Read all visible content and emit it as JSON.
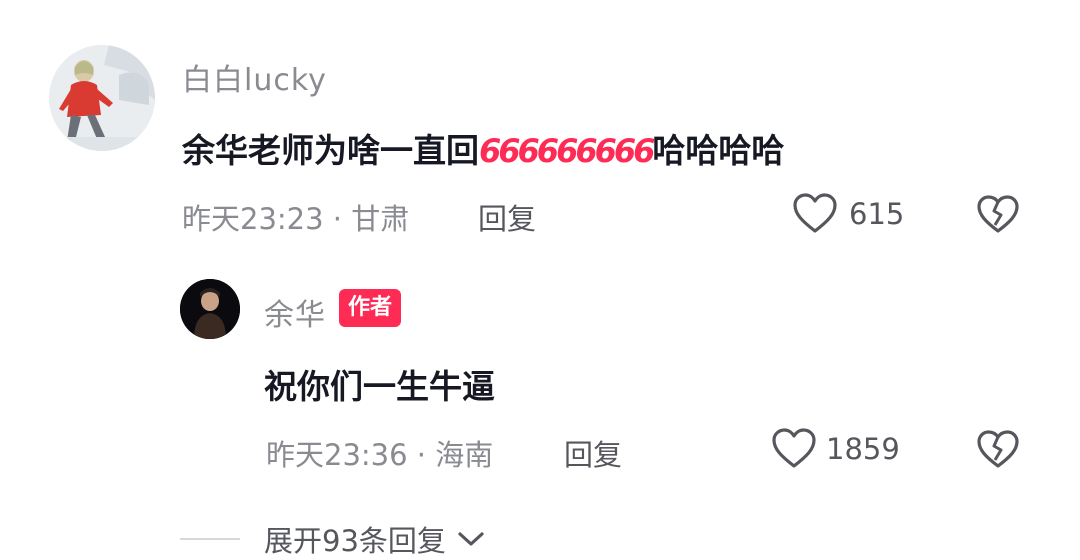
{
  "comment": {
    "username": "白白lucky",
    "text_start": "余华老师为啥一直回",
    "emoji_name": "666-emoji",
    "emoji_glyph": "666",
    "text_end": "哈哈哈哈",
    "meta": "昨天23:23 · 甘肃",
    "reply_label": "回复",
    "like_count": "615",
    "like_icon": "heart-outline-icon",
    "dislike_icon": "broken-heart-icon"
  },
  "reply": {
    "username": "余华",
    "badge": "作者",
    "text": "祝你们一生牛逼",
    "meta": "昨天23:36 · 海南",
    "reply_label": "回复",
    "like_count": "1859"
  },
  "expand": {
    "label": "展开93条回复",
    "icon": "chevron-down-icon"
  },
  "colors": {
    "accent": "#fe2c55",
    "secondary_text": "#8a8b91",
    "primary_text": "#161823"
  }
}
